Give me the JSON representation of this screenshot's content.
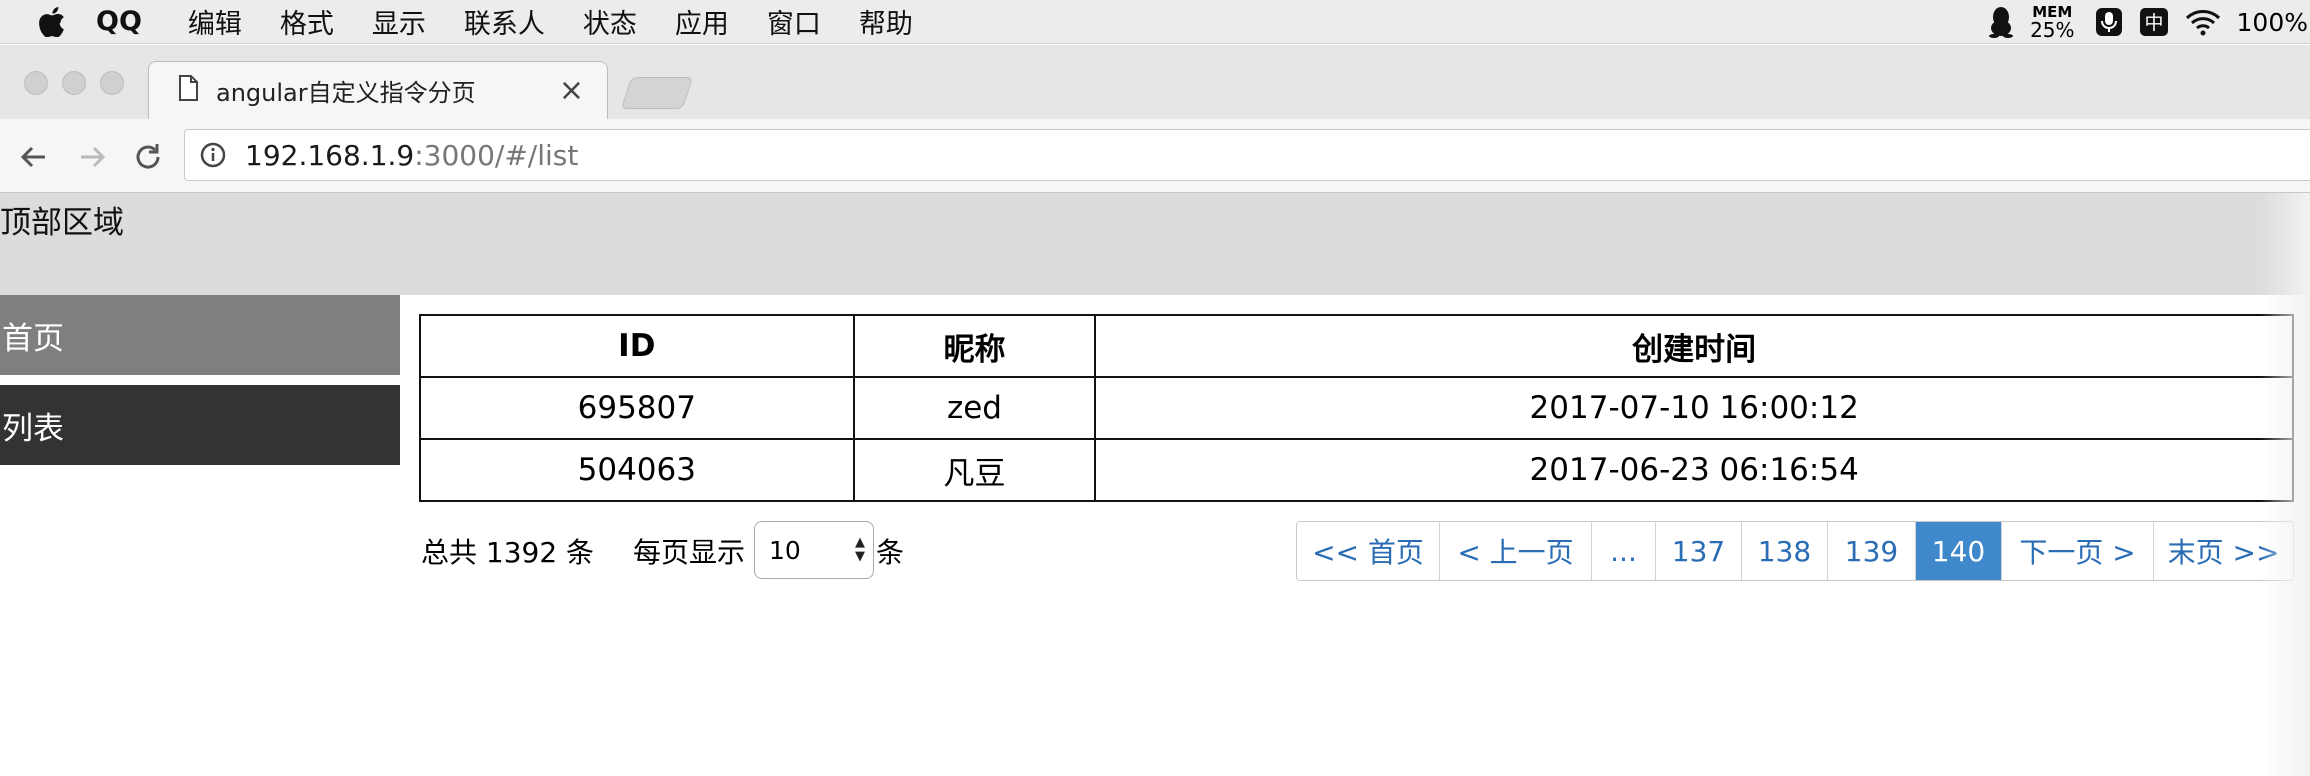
{
  "menubar": {
    "app_name": "QQ",
    "items": [
      "编辑",
      "格式",
      "显示",
      "联系人",
      "状态",
      "应用",
      "窗口",
      "帮助"
    ],
    "mem_label": "MEM",
    "mem_value": "25%",
    "ime_label": "中",
    "battery": "100%"
  },
  "browser": {
    "tab_title": "angular自定义指令分页",
    "url_host": "192.168.1.9",
    "url_path": ":3000/#/list"
  },
  "page": {
    "header_title": "顶部区域",
    "nav": {
      "home": "首页",
      "list": "列表"
    },
    "table": {
      "headers": [
        "ID",
        "昵称",
        "创建时间"
      ],
      "rows": [
        [
          "695807",
          "zed",
          "2017-07-10 16:00:12"
        ],
        [
          "504063",
          "凡豆",
          "2017-06-23 06:16:54"
        ]
      ]
    },
    "pager": {
      "total_text": "总共 1392 条",
      "perpage_label": "每页显示",
      "perpage_value": "10",
      "perpage_unit": "条",
      "first": "<< 首页",
      "prev": "< 上一页",
      "ellipsis": "...",
      "pages": [
        "137",
        "138",
        "139",
        "140"
      ],
      "active_page": "140",
      "next": "下一页 >",
      "last": "末页 >>"
    }
  },
  "colors": {
    "header_bg": "#dcdcdc",
    "nav_home_bg": "#7f7f7f",
    "nav_list_bg": "#333333",
    "pager_link": "#2a6db5",
    "pager_active": "#3f88cc"
  }
}
